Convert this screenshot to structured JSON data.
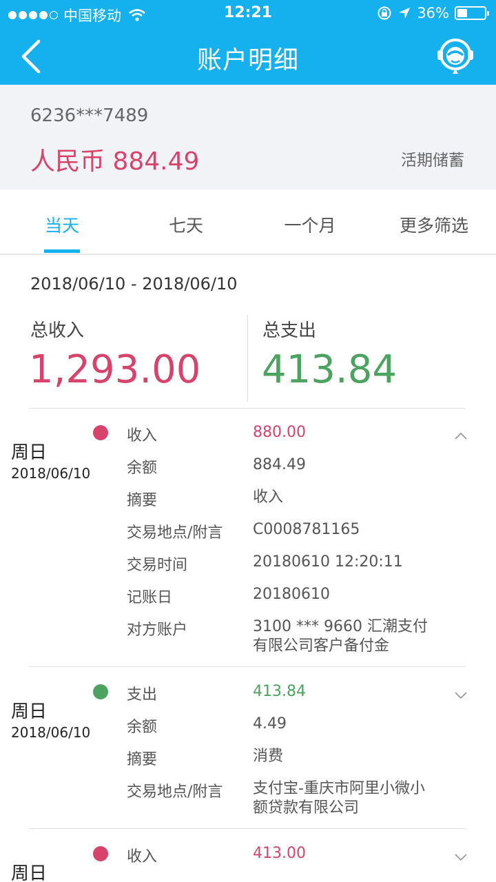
{
  "status_bar": {
    "carrier": "中国移动",
    "time": "12:21",
    "battery": "36%",
    "battery_level": 0.36
  },
  "nav": {
    "title": "账户明细",
    "back_icon": "chevron-left-icon",
    "service_icon": "customer-service-icon"
  },
  "account": {
    "number": "6236***7489",
    "balance": "人民币 884.49",
    "type": "活期储蓄"
  },
  "tabs": [
    "当天",
    "七天",
    "一个月",
    "更多筛选"
  ],
  "active_tab": 0,
  "summary": {
    "date_range": "2018/06/10 - 2018/06/10",
    "income_label": "总收入",
    "income_value": "1,293.00",
    "expense_label": "总支出",
    "expense_value": "413.84"
  },
  "colors": {
    "brand": "#15b0ee",
    "income": "#d7436b",
    "expense": "#4ca35f"
  },
  "transactions": [
    {
      "weekday": "周日",
      "date": "2018/06/10",
      "direction": "income",
      "expanded": true,
      "type_label": "收入",
      "amount": "880.00",
      "fields": {
        "balance_label": "余额",
        "balance": "884.49",
        "summary_label": "摘要",
        "summary": "收入",
        "place_label": "交易地点/附言",
        "place": "C0008781165",
        "time_label": "交易时间",
        "time": "20180610 12:20:11",
        "booking_label": "记账日",
        "booking": "20180610",
        "counterparty_label": "对方账户",
        "counterparty_line1": "3100 *** 9660 汇潮支付",
        "counterparty_line2": "有限公司客户备付金"
      }
    },
    {
      "weekday": "周日",
      "date": "2018/06/10",
      "direction": "expense",
      "expanded": false,
      "type_label": "支出",
      "amount": "413.84",
      "fields": {
        "balance_label": "余额",
        "balance": "4.49",
        "summary_label": "摘要",
        "summary": "消费",
        "place_label": "交易地点/附言",
        "place_line1": "支付宝-重庆市阿里小微小",
        "place_line2": "额贷款有限公司"
      }
    },
    {
      "weekday": "周日",
      "direction": "income",
      "expanded": false,
      "type_label": "收入",
      "amount": "413.00"
    }
  ]
}
